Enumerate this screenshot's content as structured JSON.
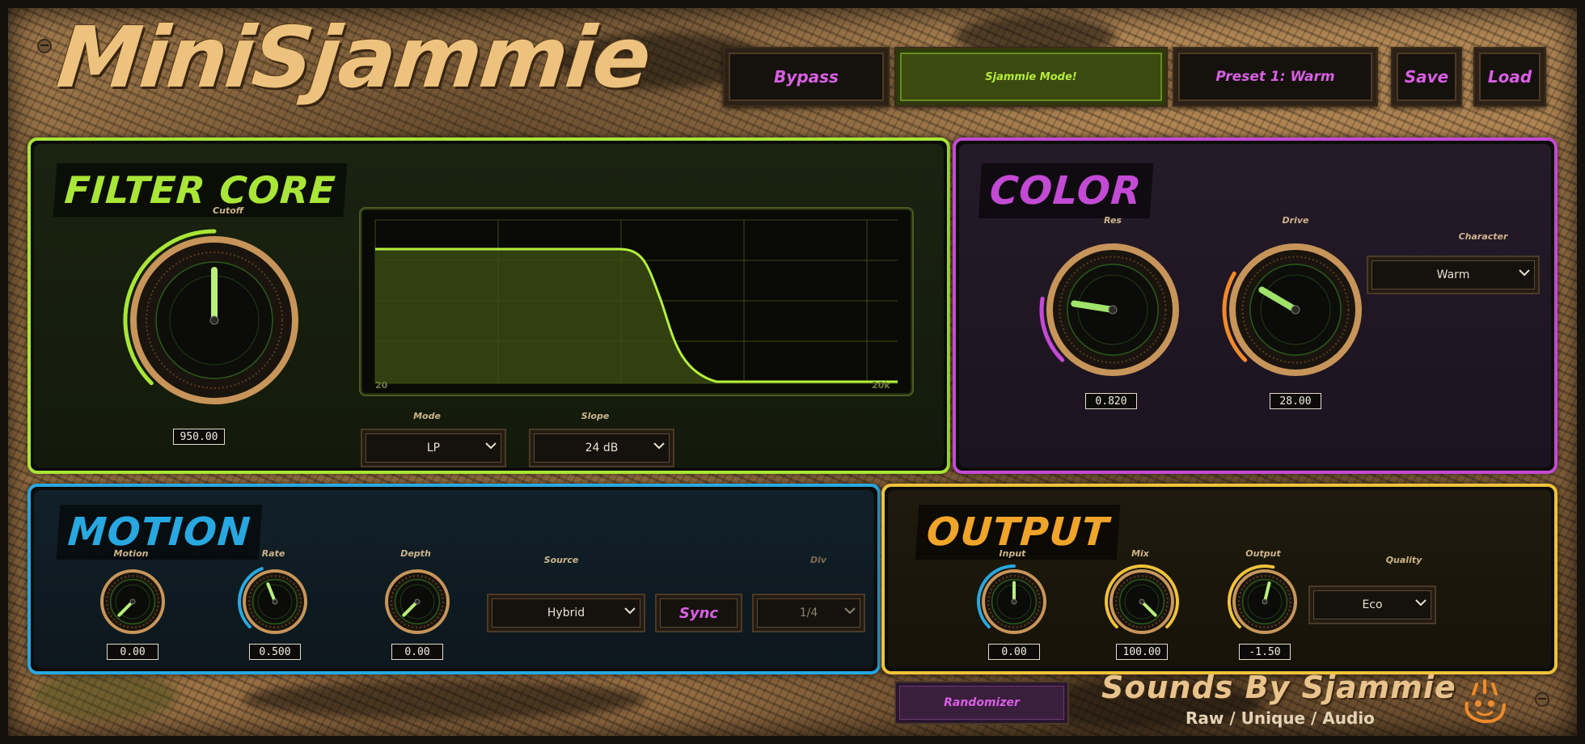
{
  "app": {
    "title": "MiniSjammie"
  },
  "header": {
    "bypass_label": "Bypass",
    "mode_label": "Sjammie Mode!",
    "preset_label": "Preset 1: Warm",
    "save_label": "Save",
    "load_label": "Load"
  },
  "filter_core": {
    "title": "FILTER CORE",
    "cutoff": {
      "label": "Cutoff",
      "value": "950.00",
      "level": 0.5
    },
    "graph": {
      "x_min_label": "20",
      "x_max_label": "20k"
    },
    "mode": {
      "label": "Mode",
      "value": "LP"
    },
    "slope": {
      "label": "Slope",
      "value": "24 dB"
    }
  },
  "color": {
    "title": "COLOR",
    "res": {
      "label": "Res",
      "value": "0.820",
      "level": 0.2
    },
    "drive": {
      "label": "Drive",
      "value": "28.00",
      "level": 0.28
    },
    "character": {
      "label": "Character",
      "value": "Warm"
    }
  },
  "motion": {
    "title": "MOTION",
    "motion": {
      "label": "Motion",
      "value": "0.00",
      "level": 0.0
    },
    "rate": {
      "label": "Rate",
      "value": "0.500",
      "level": 0.42
    },
    "depth": {
      "label": "Depth",
      "value": "0.00",
      "level": 0.0
    },
    "source": {
      "label": "Source",
      "value": "Hybrid"
    },
    "sync_label": "Sync",
    "div": {
      "label": "Div",
      "value": "1/4"
    }
  },
  "output": {
    "title": "OUTPUT",
    "input": {
      "label": "Input",
      "value": "0.00",
      "level": 0.5
    },
    "mix": {
      "label": "Mix",
      "value": "100.00",
      "level": 1.0
    },
    "output": {
      "label": "Output",
      "value": "-1.50",
      "level": 0.55
    },
    "quality": {
      "label": "Quality",
      "value": "Eco"
    }
  },
  "footer": {
    "randomizer_label": "Randomizer",
    "brand": "Sounds By Sjammie",
    "tagline": "Raw / Unique / Audio"
  },
  "colors": {
    "filter_accent": "#a9e637",
    "color_accent": "#c34ad4",
    "motion_accent": "#28a8e0",
    "output_accent": "#f0c23a",
    "wood": "#a67c4c"
  }
}
